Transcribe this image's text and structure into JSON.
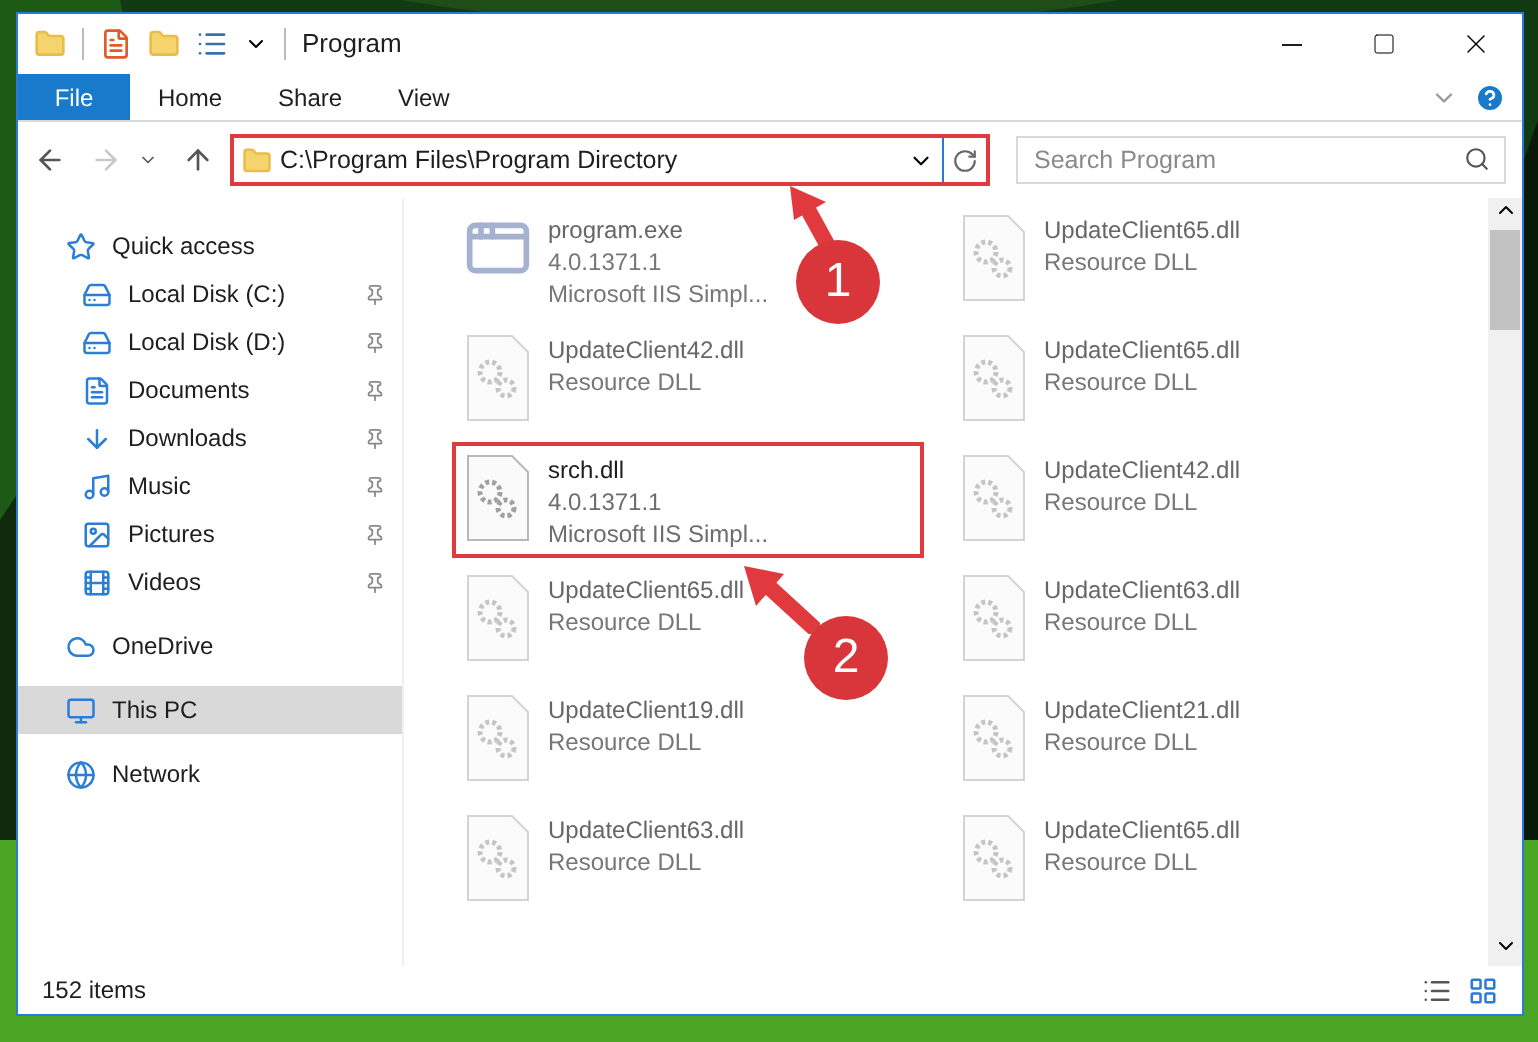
{
  "window": {
    "title": "Program"
  },
  "ribbon": {
    "file_tab": "File",
    "tabs": [
      "Home",
      "Share",
      "View"
    ]
  },
  "address": {
    "path": "C:\\Program Files\\Program Directory",
    "marked": true
  },
  "search": {
    "placeholder": "Search Program"
  },
  "sidebar": {
    "items": [
      {
        "label": "Quick access",
        "selected": false,
        "children": [
          {
            "label": "Local Disk (C:)",
            "pinned": true,
            "selected": false
          },
          {
            "label": "Local Disk (D:)",
            "pinned": true,
            "selected": false
          },
          {
            "label": "Documents",
            "pinned": true,
            "selected": false
          },
          {
            "label": "Downloads",
            "pinned": true,
            "selected": false
          },
          {
            "label": "Music",
            "pinned": true,
            "selected": false
          },
          {
            "label": "Pictures",
            "pinned": true,
            "selected": false
          },
          {
            "label": "Videos",
            "pinned": true,
            "selected": false
          }
        ]
      },
      {
        "label": "OneDrive",
        "selected": false
      },
      {
        "label": "This PC",
        "selected": true
      },
      {
        "label": "Network",
        "selected": false
      }
    ]
  },
  "files": [
    {
      "kind": "exe",
      "name": "program.exe",
      "lines": [
        "4.0.1371.1",
        "Microsoft IIS Simpl..."
      ],
      "blurred": true,
      "marked": false
    },
    {
      "kind": "dll",
      "name": "UpdateClient65.dll",
      "lines": [
        "Resource DLL"
      ],
      "blurred": true,
      "marked": false
    },
    {
      "kind": "dll",
      "name": "UpdateClient42.dll",
      "lines": [
        "Resource DLL"
      ],
      "blurred": true,
      "marked": false
    },
    {
      "kind": "dll",
      "name": "UpdateClient65.dll",
      "lines": [
        "Resource DLL"
      ],
      "blurred": true,
      "marked": false
    },
    {
      "kind": "dll",
      "name": "srch.dll",
      "lines": [
        "4.0.1371.1",
        "Microsoft IIS Simpl..."
      ],
      "blurred": false,
      "marked": true
    },
    {
      "kind": "dll",
      "name": "UpdateClient42.dll",
      "lines": [
        "Resource DLL"
      ],
      "blurred": true,
      "marked": false
    },
    {
      "kind": "dll",
      "name": "UpdateClient65.dll",
      "lines": [
        "Resource DLL"
      ],
      "blurred": true,
      "marked": false
    },
    {
      "kind": "dll",
      "name": "UpdateClient63.dll",
      "lines": [
        "Resource DLL"
      ],
      "blurred": true,
      "marked": false
    },
    {
      "kind": "dll",
      "name": "UpdateClient19.dll",
      "lines": [
        "Resource DLL"
      ],
      "blurred": true,
      "marked": false
    },
    {
      "kind": "dll",
      "name": "UpdateClient21.dll",
      "lines": [
        "Resource DLL"
      ],
      "blurred": true,
      "marked": false
    },
    {
      "kind": "dll",
      "name": "UpdateClient63.dll",
      "lines": [
        "Resource DLL"
      ],
      "blurred": true,
      "marked": false
    },
    {
      "kind": "dll",
      "name": "UpdateClient65.dll",
      "lines": [
        "Resource DLL"
      ],
      "blurred": true,
      "marked": false
    }
  ],
  "status_bar": {
    "count": "152 items"
  },
  "annotations": [
    {
      "label": "1"
    },
    {
      "label": "2"
    }
  ]
}
